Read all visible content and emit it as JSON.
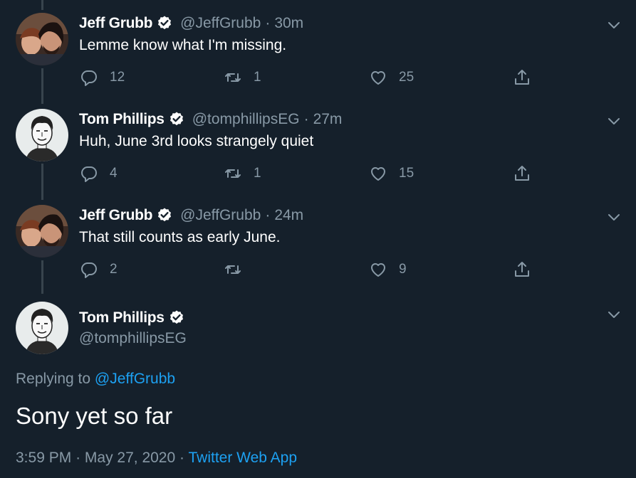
{
  "colors": {
    "background": "#15202b",
    "secondary_text": "#8899a6",
    "accent": "#1da1f2",
    "thread_line": "#38444d"
  },
  "tweets": [
    {
      "name": "Jeff Grubb",
      "handle": "@JeffGrubb",
      "separator": "·",
      "time": "30m",
      "text": "Lemme know what I'm missing.",
      "replies": "12",
      "retweets": "1",
      "likes": "25",
      "avatar": "jeff-grubb-avatar",
      "verified_icon": "verified-badge-icon"
    },
    {
      "name": "Tom Phillips",
      "handle": "@tomphillipsEG",
      "separator": "·",
      "time": "27m",
      "text": "Huh, June 3rd looks strangely quiet",
      "replies": "4",
      "retweets": "1",
      "likes": "15",
      "avatar": "tom-phillips-avatar",
      "verified_icon": "verified-badge-icon"
    },
    {
      "name": "Jeff Grubb",
      "handle": "@JeffGrubb",
      "separator": "·",
      "time": "24m",
      "text": "That still counts as early June.",
      "replies": "2",
      "retweets": "",
      "likes": "9",
      "avatar": "jeff-grubb-avatar",
      "verified_icon": "verified-badge-icon"
    }
  ],
  "main_tweet": {
    "name": "Tom Phillips",
    "handle": "@tomphillipsEG",
    "replying_prefix": "Replying to",
    "replying_to": "@JeffGrubb",
    "text": "Sony yet so far",
    "time": "3:59 PM",
    "separator": "·",
    "date": "May 27, 2020",
    "source": "Twitter Web App",
    "avatar": "tom-phillips-avatar"
  },
  "icons": {
    "reply": "reply-icon",
    "retweet": "retweet-icon",
    "like": "heart-icon",
    "share": "share-icon",
    "more": "chevron-down-icon"
  }
}
